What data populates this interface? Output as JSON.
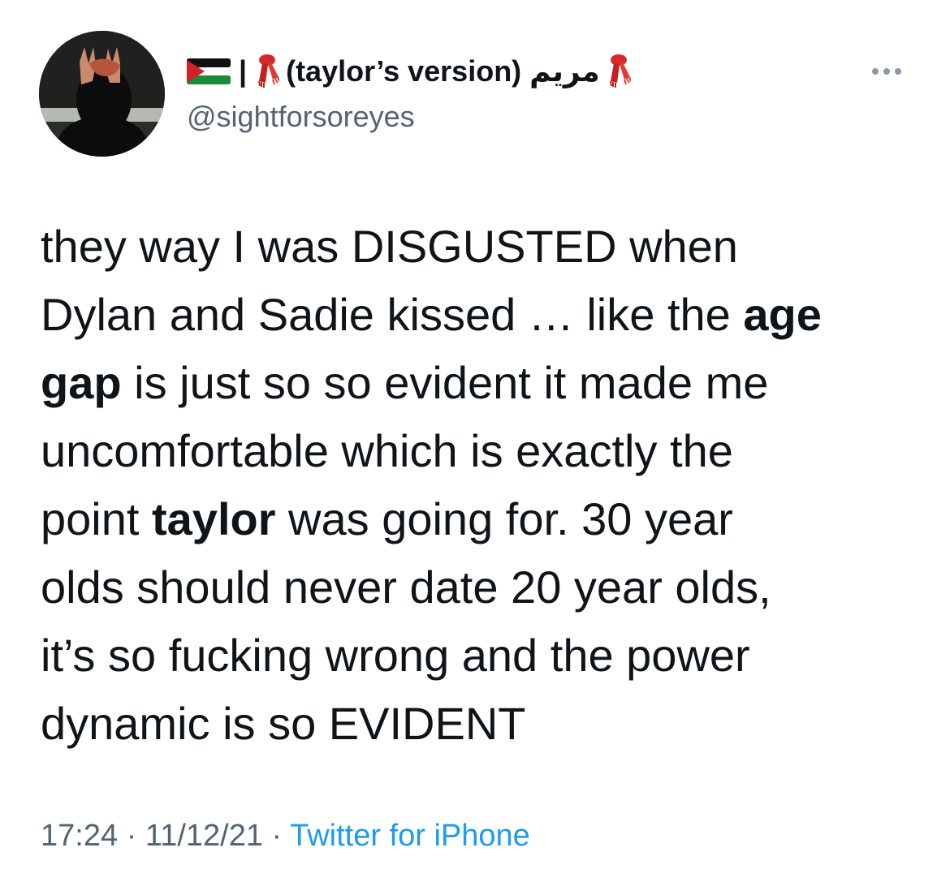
{
  "user": {
    "display_name_separator": "|",
    "display_name_text": "(taylor’s version) مريم",
    "handle": "@sightforsoreyes",
    "avatar_icon": "profile-photo",
    "flag_icon": "palestine-flag-icon",
    "scarf_icon": "red-scarf-emoji-icon"
  },
  "tweet": {
    "lines": [
      {
        "segments": [
          {
            "text": "they way I was DISGUSTED when",
            "bold": false
          }
        ]
      },
      {
        "segments": [
          {
            "text": "Dylan and Sadie kissed … like the ",
            "bold": false
          },
          {
            "text": "age",
            "bold": true
          }
        ]
      },
      {
        "segments": [
          {
            "text": "gap",
            "bold": true
          },
          {
            "text": " is just so so evident it made me",
            "bold": false
          }
        ]
      },
      {
        "segments": [
          {
            "text": "uncomfortable which is exactly the",
            "bold": false
          }
        ]
      },
      {
        "segments": [
          {
            "text": "point ",
            "bold": false
          },
          {
            "text": "taylor",
            "bold": true
          },
          {
            "text": " was going for. 30 year",
            "bold": false
          }
        ]
      },
      {
        "segments": [
          {
            "text": "olds should never date 20 year olds,",
            "bold": false
          }
        ]
      },
      {
        "segments": [
          {
            "text": "it’s so fucking wrong and the power",
            "bold": false
          }
        ]
      },
      {
        "segments": [
          {
            "text": "dynamic is so EVIDENT",
            "bold": false
          }
        ]
      }
    ]
  },
  "meta": {
    "time": "17:24",
    "dot1": "·",
    "date": "11/12/21",
    "dot2": "·",
    "source": "Twitter for iPhone"
  },
  "colors": {
    "text_primary": "#0f1419",
    "text_secondary": "#536471",
    "link": "#1d9bf0"
  }
}
